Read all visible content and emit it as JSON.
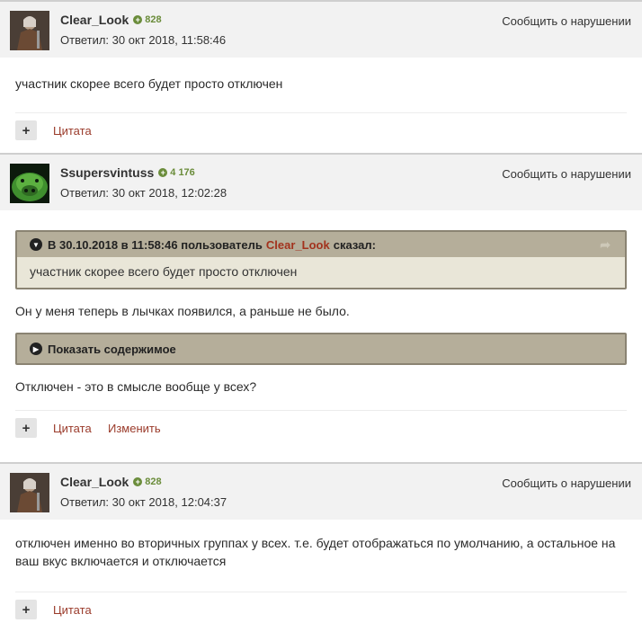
{
  "posts": [
    {
      "author": "Clear_Look",
      "rep": "828",
      "date": "Ответил: 30 окт 2018, 11:58:46",
      "report": "Сообщить о нарушении",
      "text": "участник скорее всего будет просто отключен",
      "actions": {
        "plus": "+",
        "quote": "Цитата"
      }
    },
    {
      "author": "Ssupersvintuss",
      "rep": "4 176",
      "date": "Ответил: 30 окт 2018, 12:02:28",
      "report": "Сообщить о нарушении",
      "quote": {
        "prefix": "В 30.10.2018 в 11:58:46 пользователь",
        "user": "Clear_Look",
        "suffix": "сказал:",
        "text": "участник скорее всего будет просто отключен"
      },
      "text1": "Он у меня теперь в лычках появился, а раньше не было.",
      "spoiler": "Показать содержимое",
      "text2": "Отключен - это в смысле вообще у всех?",
      "actions": {
        "plus": "+",
        "quote": "Цитата",
        "edit": "Изменить"
      }
    },
    {
      "author": "Clear_Look",
      "rep": "828",
      "date": "Ответил: 30 окт 2018, 12:04:37",
      "report": "Сообщить о нарушении",
      "text": "отключен именно во вторичных группах у всех. т.е. будет отображаться по умолчанию, а остальное на ваш вкус включается и отключается",
      "actions": {
        "plus": "+",
        "quote": "Цитата"
      }
    }
  ],
  "colors": {
    "accent_link": "#9a3a2a",
    "rep_green": "#6a8c3a",
    "quote_border": "#8a8372"
  }
}
